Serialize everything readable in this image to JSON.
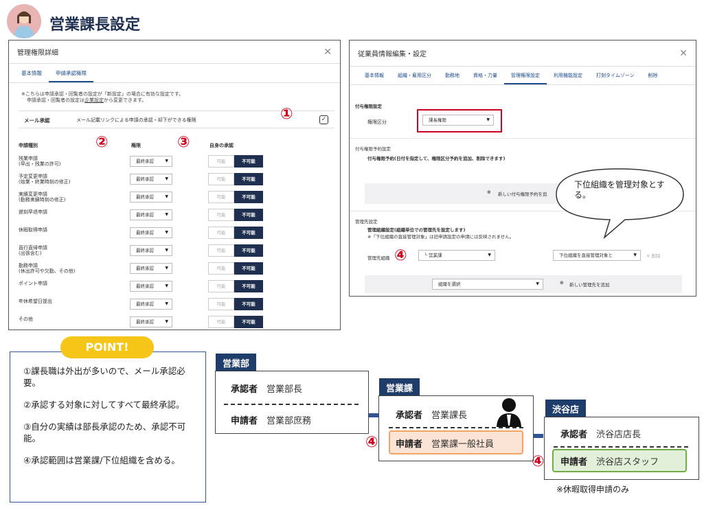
{
  "page": {
    "title": "営業課長設定"
  },
  "left": {
    "title": "管理権限詳細",
    "tabs": [
      "基本情報",
      "申請承認権限"
    ],
    "note1": "※こちらは申請承認・回覧者の設定が「新設定」の場合に有効な設定です。",
    "note2a": "申請承認・回覧者の設定は",
    "note2link": "企業設定",
    "note2b": "から変更できます。",
    "mail_label": "メール承認",
    "mail_desc": "メール記載リンクによる申請の承認・却下ができる権限",
    "headers": [
      "申請種別",
      "権限",
      "自身の承認"
    ],
    "rows": [
      {
        "name": "残業申請",
        "sub": "(早出・残業の許可)"
      },
      {
        "name": "予定変更申請",
        "sub": "(始業・終業時刻の修正)"
      },
      {
        "name": "実績変更申請",
        "sub": "(勤務実績時刻の修正)"
      },
      {
        "name": "遅刻早退申請",
        "sub": ""
      },
      {
        "name": "休暇取得申請",
        "sub": ""
      },
      {
        "name": "直行直帰申請",
        "sub": "(出張含む)"
      },
      {
        "name": "勤務申請",
        "sub": "(休出許可や欠勤、その他)"
      },
      {
        "name": "ポイント申請",
        "sub": ""
      },
      {
        "name": "年休希望日提出",
        "sub": ""
      },
      {
        "name": "その他",
        "sub": ""
      }
    ],
    "perm": "最終承認",
    "toggle_off": "可能",
    "toggle_on": "不可能"
  },
  "right": {
    "title": "従業員情報編集・設定",
    "tabs": [
      "基本情報",
      "組織・雇用区分",
      "勤務地",
      "資格・力量",
      "管理権限設定",
      "利用機能設定",
      "打刻タイムゾーン",
      "削除"
    ],
    "sec1": "付与権限設定",
    "role_label": "権限区分",
    "role_value": "課長権限",
    "sec2": "付与権限予約設定",
    "sec2_desc": "付与権限予約(日付を指定して、権限区分予約を追加、削除できます)",
    "add_reserve": "新しい付与権限予約を追",
    "sec3": "管理先設定",
    "sec3_desc": "管理組織設定(組織単位での管理先を設定します)",
    "sec3_note": "※「下位組織の直接管理対象」は旧申請設定の申請には反映されません。",
    "org_label": "管理先組織",
    "org_value": "└ 営業課",
    "scope_value": "下位組織を直接管理対象と",
    "delete": "削除",
    "select_org": "組織を選択",
    "add_org": "新しい管理先を追加",
    "bubble": "下位組織を管理対象とする。"
  },
  "markers": [
    "①",
    "②",
    "③",
    "④"
  ],
  "point": {
    "badge": "POINT!",
    "items": [
      "①課長職は外出が多いので、メール承認必要。",
      "②承認する対象に対してすべて最終承認。",
      "③自分の実績は部長承認のため、承認不可能。",
      "④承認範囲は営業課/下位組織を含める。"
    ]
  },
  "org": {
    "dept": {
      "label": "営業部",
      "approver_k": "承認者",
      "approver": "営業部長",
      "applicant_k": "申請者",
      "applicant": "営業部庶務"
    },
    "sect": {
      "label": "営業課",
      "approver_k": "承認者",
      "approver": "営業課長",
      "applicant_k": "申請者",
      "applicant": "営業課一般社員"
    },
    "shop": {
      "label": "渋谷店",
      "approver_k": "承認者",
      "approver": "渋谷店店長",
      "applicant_k": "申請者",
      "applicant": "渋谷店スタッフ"
    },
    "footnote": "※休暇取得申請のみ"
  }
}
